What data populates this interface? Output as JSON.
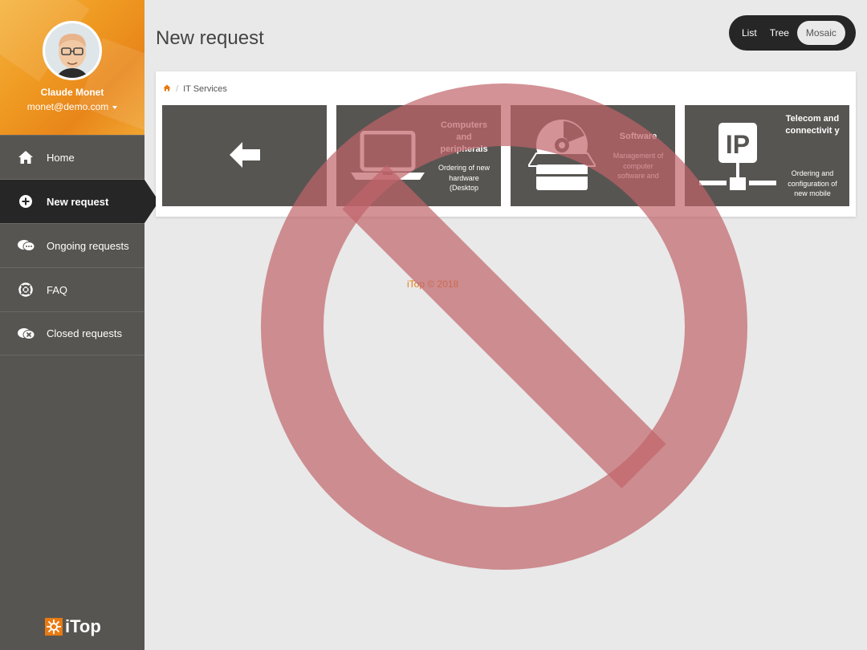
{
  "user": {
    "name": "Claude Monet",
    "email": "monet@demo.com"
  },
  "sidebar": {
    "items": [
      {
        "label": "Home",
        "icon": "home-icon"
      },
      {
        "label": "New request",
        "icon": "plus-circle-icon",
        "active": true
      },
      {
        "label": "Ongoing requests",
        "icon": "chat-bubbles-icon"
      },
      {
        "label": "FAQ",
        "icon": "lifebuoy-icon"
      },
      {
        "label": "Closed requests",
        "icon": "chat-closed-icon"
      }
    ],
    "logo_text": "iTop"
  },
  "header": {
    "title": "New request",
    "view_modes": [
      "List",
      "Tree",
      "Mosaic"
    ],
    "active_view": "Mosaic"
  },
  "breadcrumb": {
    "home_icon": "home-icon",
    "current": "IT Services"
  },
  "tiles": [
    {
      "kind": "back",
      "icon": "arrow-left-icon"
    },
    {
      "title": "Computers and peripherals",
      "description": "Ordering of new hardware (Desktop",
      "icon": "laptop-icon"
    },
    {
      "title": "Software",
      "description": "Management of computer software and",
      "icon": "software-box-icon"
    },
    {
      "title": "Telecom and connectivit y",
      "description": "Ordering and configuration of new mobile",
      "icon": "ip-network-icon"
    }
  ],
  "footer": {
    "text": "iTop © 2018"
  },
  "colors": {
    "accent": "#e87a12",
    "sidebar": "#575551",
    "active": "#262626",
    "overlay": "#c0646a"
  }
}
